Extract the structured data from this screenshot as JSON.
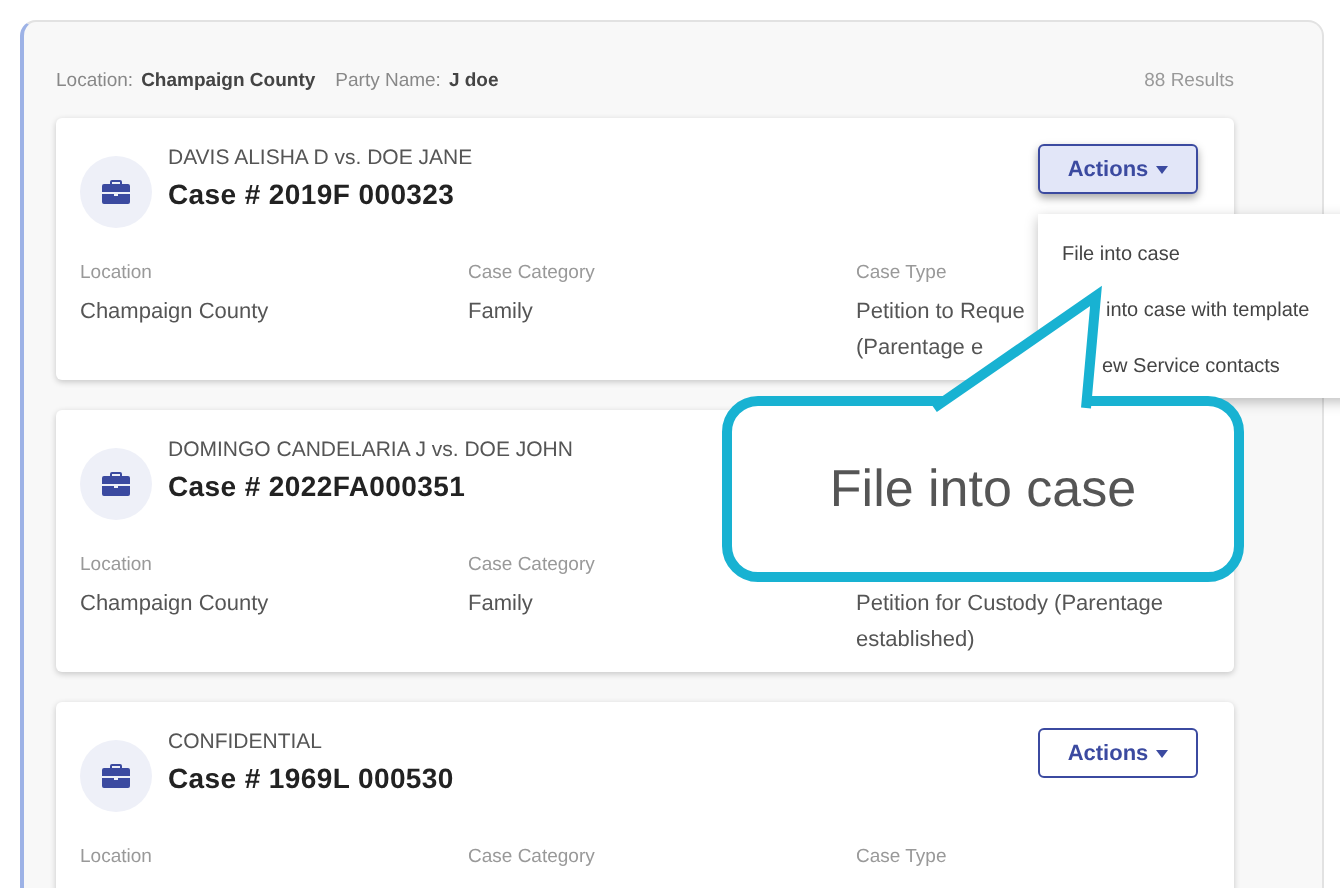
{
  "filters": [
    {
      "label": "Location:",
      "value": "Champaign County"
    },
    {
      "label": "Party Name:",
      "value": "J doe"
    }
  ],
  "results": "88 Results",
  "cases": [
    {
      "parties": "DAVIS ALISHA D vs. DOE JANE",
      "number": "Case # 2019F 000323",
      "fields": [
        {
          "label": "Location",
          "value": "Champaign County"
        },
        {
          "label": "Case Category",
          "value": "Family"
        },
        {
          "label": "Case Type",
          "value": "Petition to Reque\n(Parentage e"
        }
      ],
      "actions": {
        "label": "Actions",
        "open": true
      }
    },
    {
      "parties": "DOMINGO CANDELARIA J vs. DOE JOHN",
      "number": "Case # 2022FA000351",
      "fields": [
        {
          "label": "Location",
          "value": "Champaign County"
        },
        {
          "label": "Case Category",
          "value": "Family"
        },
        {
          "value": "Petition for Custody (Parentage established)"
        }
      ]
    },
    {
      "parties": "CONFIDENTIAL",
      "number": "Case # 1969L 000530",
      "fields": [
        {
          "label": "Location"
        },
        {
          "label": "Case Category"
        },
        {
          "label": "Case Type"
        }
      ],
      "actions": {
        "label": "Actions",
        "open": false
      }
    }
  ],
  "menu": [
    "File into case",
    "into case with template",
    "ew Service contacts"
  ],
  "callout": "File into case"
}
